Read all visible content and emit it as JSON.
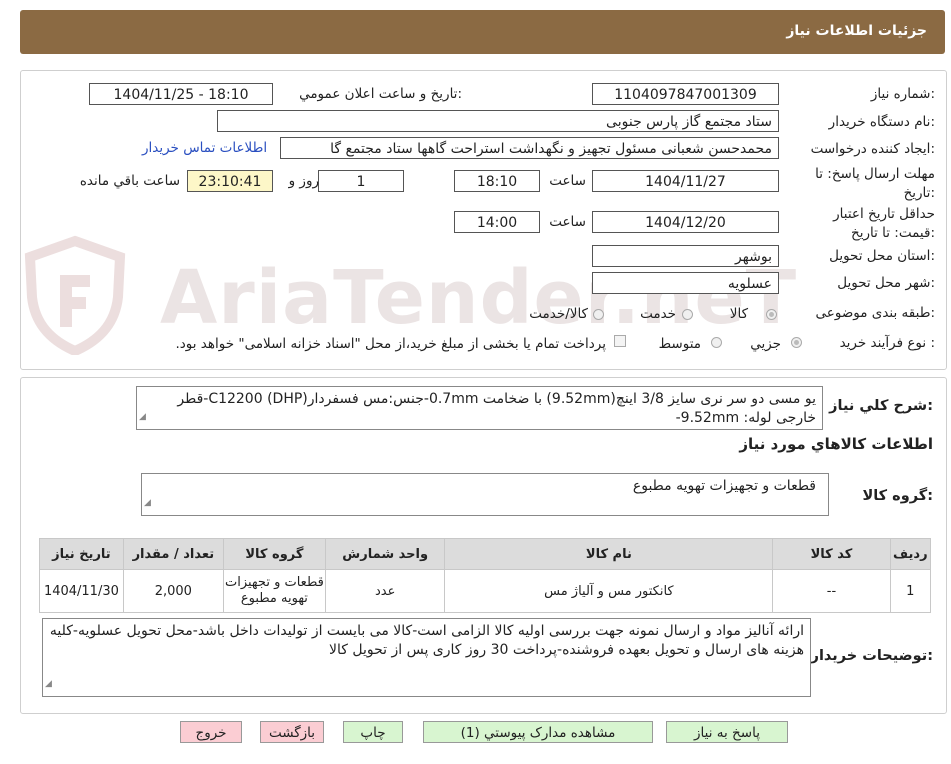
{
  "header": {
    "title": "جزئیات اطلاعات نیاز"
  },
  "watermark": {
    "text": "AriaTender.neT"
  },
  "form": {
    "need_number": {
      "label": "شماره نیاز:",
      "value": "1104097847001309"
    },
    "announce": {
      "label": "تاریخ و ساعت اعلان عمومي:",
      "value": "1404/11/25 - 18:10"
    },
    "buyer": {
      "label": "نام دستگاه خريدار:",
      "value": "ستاد مجتمع گاز پارس جنوبی"
    },
    "requester": {
      "label": "ايجاد کننده درخواست:",
      "value": "محمدحسن شعبانی مسئول تجهیز و نگهداشت استراحت گاهها ستاد مجتمع گا",
      "contact_link": "اطلاعات تماس خريدار"
    },
    "reply_deadline": {
      "label_line1": "مهلت ارسال پاسخ: تا",
      "label_line2": "تاريخ:",
      "date": "1404/11/27",
      "time_label": "ساعت",
      "time": "18:10",
      "days": "1",
      "days_label": "روز و",
      "remaining": "23:10:41",
      "remaining_label": "ساعت باقي مانده"
    },
    "price_validity": {
      "label_line1": "حداقل تاريخ اعتبار",
      "label_line2": "قيمت: تا تاريخ:",
      "date": "1404/12/20",
      "time_label": "ساعت",
      "time": "14:00"
    },
    "province": {
      "label": "استان محل تحويل:",
      "value": "بوشهر"
    },
    "city": {
      "label": "شهر محل تحويل:",
      "value": "عسلويه"
    },
    "category": {
      "label": "طبقه بندی موضوعی:",
      "options": [
        "کالا",
        "خدمت",
        "کالا/خدمت"
      ],
      "selected": "کالا"
    },
    "process": {
      "label": "نوع فرآیند خرید :",
      "options": [
        "جزیي",
        "متوسط"
      ],
      "selected": "جزیي",
      "note": "پرداخت تمام یا بخشی از مبلغ خرید،از محل \"اسناد خزانه اسلامی\" خواهد بود."
    }
  },
  "description": {
    "label": "شرح کلي نياز:",
    "text": "یو مسی دو سر نری سایز 3/8 اینچ(9.52mm) با ضخامت 0.7mm-جنس:مس فسفردار(C12200 (DHP-قطر خارجی لوله: 9.52mm-"
  },
  "goods_section": {
    "title": "اطلاعات کالاهاي مورد نياز",
    "group_label": "گروه کالا:",
    "group_value": "قطعات و تجهیزات تهویه مطبوع"
  },
  "table": {
    "headers": [
      "رديف",
      "کد کالا",
      "نام کالا",
      "واحد شمارش",
      "گروه کالا",
      "تعداد / مقدار",
      "تاريخ نياز"
    ],
    "rows": [
      {
        "row": "1",
        "code": "--",
        "name": "کانکتور مس و آلیاژ مس",
        "unit": "عدد",
        "group": "قطعات و تجهیزات تهویه مطبوع",
        "qty": "2,000",
        "date": "1404/11/30"
      }
    ]
  },
  "buyer_notes": {
    "label": "توضيحات خريدار:",
    "text": "ارائه آنالیز مواد و ارسال نمونه جهت بررسی اولیه کالا الزامی است-کالا می بایست از تولیدات داخل باشد-محل تحویل عسلویه-کلیه هزینه های ارسال و تحویل بعهده فروشنده-پرداخت 30 روز کاری پس از تحویل کالا"
  },
  "buttons": {
    "reply": "پاسخ به نياز",
    "view_docs": "مشاهده مدارک پيوستي (1)",
    "print": "چاپ",
    "back": "بازگشت",
    "exit": "خروج"
  },
  "colors": {
    "header_bg": "#8b6a43",
    "button_green": "#d8f5d0",
    "button_pink": "#fbcdd3",
    "highlight_yellow": "#fdf7c8",
    "link": "#2a4fc0"
  }
}
